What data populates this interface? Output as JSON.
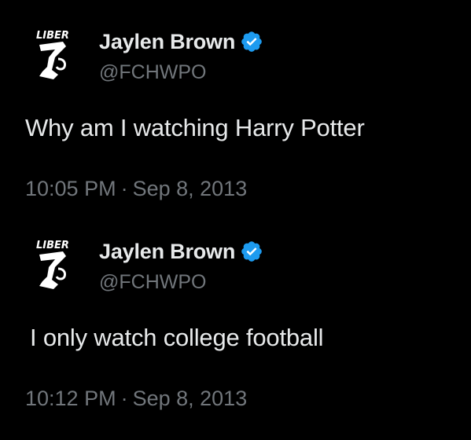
{
  "colors": {
    "background": "#000000",
    "text_primary": "#e7e9ea",
    "text_secondary": "#71767b",
    "verified_badge": "#1d9bf0"
  },
  "tweets": [
    {
      "avatar_icon": "liberty-logo-avatar-icon",
      "display_name": "Jaylen Brown",
      "verified_icon": "verified-badge-icon",
      "handle": "@FCHWPO",
      "text": "Why am I watching Harry Potter",
      "time": "10:05 PM",
      "separator": "·",
      "date": "Sep 8, 2013"
    },
    {
      "avatar_icon": "liberty-logo-avatar-icon",
      "display_name": "Jaylen Brown",
      "verified_icon": "verified-badge-icon",
      "handle": "@FCHWPO",
      "text": "I only watch college football",
      "time": "10:12 PM",
      "separator": "·",
      "date": "Sep 8, 2013"
    }
  ]
}
